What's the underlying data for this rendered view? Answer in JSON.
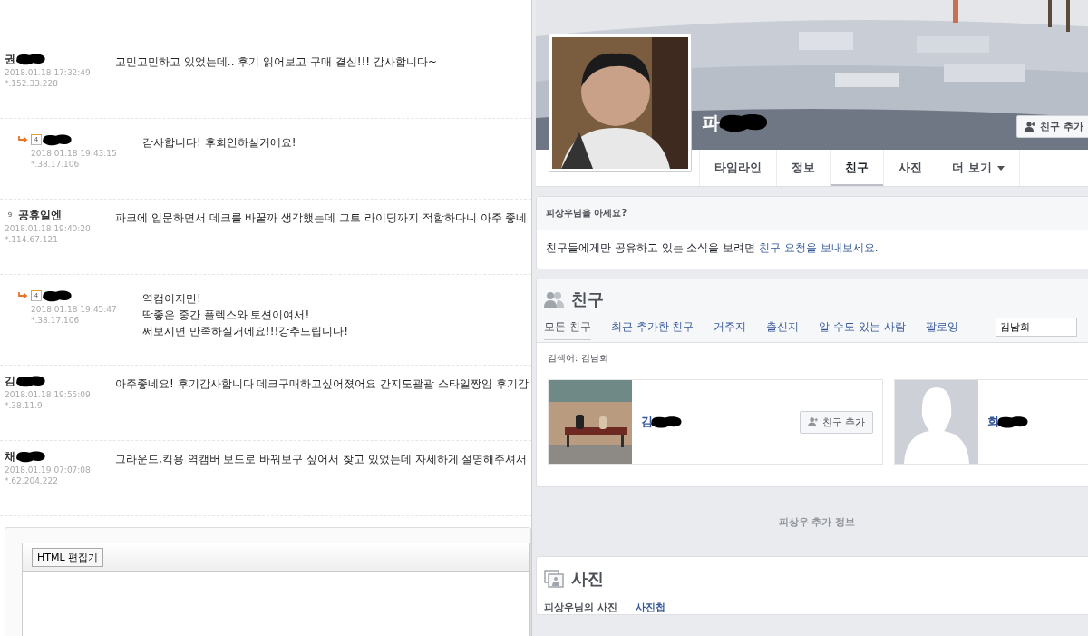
{
  "comments": [
    {
      "author": "권",
      "redacted": true,
      "reply": false,
      "date": "2018.01.18 17:32:49",
      "ip": "*.152.33.228",
      "lines": [
        "고민고민하고 있었는데.. 후기 읽어보고 구매 결심!!! 감사합니다~"
      ]
    },
    {
      "badge": "4",
      "redacted": true,
      "reply": true,
      "date": "2018.01.18 19:43:15",
      "ip": "*.38.17.106",
      "lines": [
        "감사합니다! 후회안하실거에요!"
      ]
    },
    {
      "author": "공휴일엔",
      "badge": "9",
      "redacted": false,
      "reply": false,
      "date": "2018.01.18 19:40:20",
      "ip": "*.114.67.121",
      "lines": [
        "파크에 입문하면서 데크를 바꿀까 생각했는데 그트 라이딩까지 적합하다니 아주 좋네"
      ]
    },
    {
      "badge": "4",
      "redacted": true,
      "reply": true,
      "date": "2018.01.18 19:45:47",
      "ip": "*.38.17.106",
      "lines": [
        "역캠이지만!",
        "딱좋은 중간 플렉스와 토션이여서!",
        "써보시면 만족하실거에요!!!강추드립니다!"
      ]
    },
    {
      "author": "김",
      "redacted": true,
      "reply": false,
      "date": "2018.01.18 19:55:09",
      "ip": "*.38.11.9",
      "lines": [
        "아주좋네요! 후기감사합니다 데크구매하고싶어졌어요 간지도괄괄 스타일짱임 후기감"
      ]
    },
    {
      "author": "채",
      "redacted": true,
      "reply": false,
      "date": "2018.01.19 07:07:08",
      "ip": "*.62.204.222",
      "lines": [
        "그라운드,킥용 역캠버 보드로 바꿔보구 싶어서 찾고 있었는데 자세하게 설명해주셔서"
      ]
    }
  ],
  "editor": {
    "mode_button": "HTML 편집기"
  },
  "profile": {
    "name": "파",
    "redacted": true,
    "add_friend": "친구 추가",
    "tabs": [
      {
        "label": "타임라인",
        "selected": false
      },
      {
        "label": "정보",
        "selected": false
      },
      {
        "label": "친구",
        "selected": true
      },
      {
        "label": "사진",
        "selected": false
      },
      {
        "label": "더 보기",
        "selected": false,
        "dropdown": true
      }
    ]
  },
  "know_card": {
    "title": "피상우님을 아세요?",
    "text": "친구들에게만 공유하고 있는 소식을 보려면 ",
    "link": "친구 요청을 보내보세요."
  },
  "friends": {
    "title": "친구",
    "tabs": [
      {
        "label": "모든 친구",
        "selected": true
      },
      {
        "label": "최근 추가한 친구",
        "selected": false
      },
      {
        "label": "거주지",
        "selected": false
      },
      {
        "label": "출신지",
        "selected": false
      },
      {
        "label": "알 수도 있는 사람",
        "selected": false
      },
      {
        "label": "팔로잉",
        "selected": false
      }
    ],
    "search_value": "김남회",
    "search_result": "검색어: 김남회",
    "cards": [
      {
        "name": "김",
        "kind": "picture",
        "redacted": true,
        "button": "친구 추가"
      },
      {
        "name": "회",
        "kind": "default",
        "redacted": true
      }
    ]
  },
  "divider": "피상우 추가 정보",
  "photos": {
    "title": "사진",
    "tabs": [
      {
        "label": "피상우님의 사진",
        "selected": true
      },
      {
        "label": "사진첩",
        "selected": false
      }
    ]
  }
}
